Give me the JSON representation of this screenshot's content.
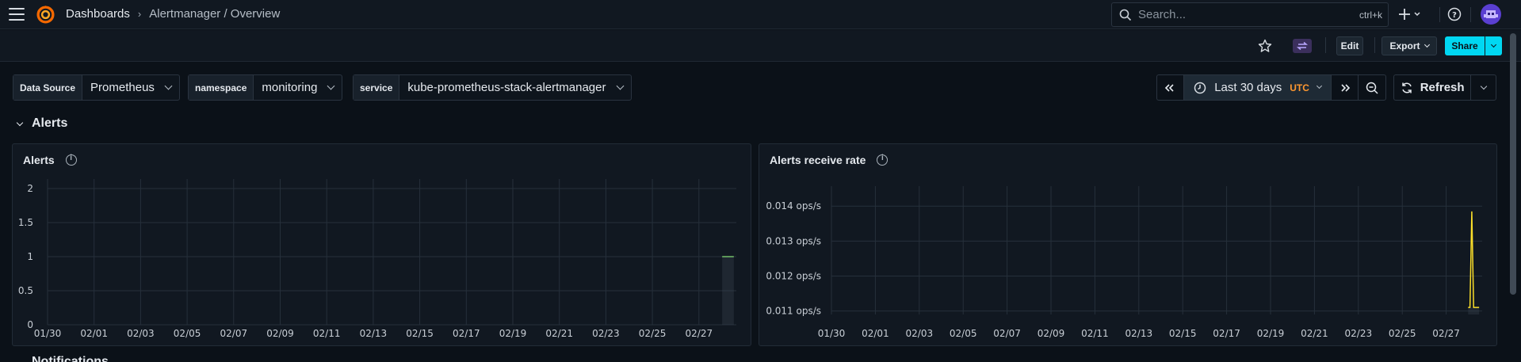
{
  "nav": {
    "breadcrumb_root": "Dashboards",
    "breadcrumb_sep": "›",
    "breadcrumb_current": "Alertmanager / Overview",
    "search_placeholder": "Search...",
    "search_shortcut": "ctrl+k"
  },
  "toolbar": {
    "edit": "Edit",
    "export": "Export",
    "share": "Share"
  },
  "variables": [
    {
      "label": "Data Source",
      "value": "Prometheus"
    },
    {
      "label": "namespace",
      "value": "monitoring"
    },
    {
      "label": "service",
      "value": "kube-prometheus-stack-alertmanager"
    }
  ],
  "timepicker": {
    "range": "Last 30 days",
    "tz": "UTC",
    "refresh": "Refresh"
  },
  "section": {
    "title": "Alerts",
    "next": "Notifications"
  },
  "colors": {
    "accent": "#00d7f2",
    "green": "#73bf69",
    "yellow": "#fade2a",
    "tz": "#ff9830"
  },
  "panels": [
    {
      "title": "Alerts"
    },
    {
      "title": "Alerts receive rate"
    }
  ],
  "chart_data": [
    {
      "type": "line",
      "title": "Alerts",
      "x_ticks": [
        "01/30",
        "02/01",
        "02/03",
        "02/05",
        "02/07",
        "02/09",
        "02/11",
        "02/13",
        "02/15",
        "02/17",
        "02/19",
        "02/21",
        "02/23",
        "02/25",
        "02/27"
      ],
      "y_ticks": [
        "2",
        "1.5",
        "1",
        "0.5",
        "0"
      ],
      "ylim": [
        0,
        2
      ],
      "series": [
        {
          "color": "#73bf69",
          "points": [
            [
              "02/28 00:00",
              1
            ],
            [
              "02/28 12:00",
              1
            ]
          ]
        }
      ]
    },
    {
      "type": "line",
      "title": "Alerts receive rate",
      "x_ticks": [
        "01/30",
        "02/01",
        "02/03",
        "02/05",
        "02/07",
        "02/09",
        "02/11",
        "02/13",
        "02/15",
        "02/17",
        "02/19",
        "02/21",
        "02/23",
        "02/25",
        "02/27"
      ],
      "y_ticks": [
        "0.014 ops/s",
        "0.013 ops/s",
        "0.012 ops/s",
        "0.011 ops/s"
      ],
      "ylim": [
        0.0109,
        0.0143
      ],
      "series": [
        {
          "color": "#fade2a",
          "points": [
            [
              "02/28 00:00",
              0.0111
            ],
            [
              "02/28 02:00",
              0.0111
            ],
            [
              "02/28 04:00",
              0.01385
            ],
            [
              "02/28 06:00",
              0.0111
            ],
            [
              "02/28 12:00",
              0.0111
            ]
          ]
        }
      ]
    }
  ]
}
